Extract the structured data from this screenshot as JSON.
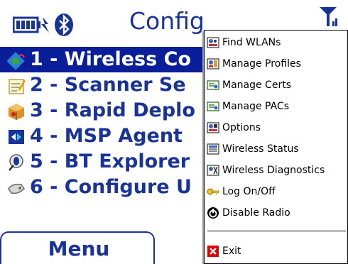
{
  "title": "Config",
  "status_icons": [
    "battery-icon",
    "bluetooth-icon",
    "antenna-icon"
  ],
  "list": [
    {
      "label": "1 - Wireless Co",
      "icon": "wireless-icon",
      "selected": true
    },
    {
      "label": "2 - Scanner Se",
      "icon": "notepad-icon",
      "selected": false
    },
    {
      "label": "3 - Rapid Deplo",
      "icon": "package-icon",
      "selected": false
    },
    {
      "label": "4 - MSP Agent",
      "icon": "msp-agent-icon",
      "selected": false
    },
    {
      "label": "5 - BT Explorer",
      "icon": "bluetooth-explorer-icon",
      "selected": false
    },
    {
      "label": "6 - Configure U",
      "icon": "configure-icon",
      "selected": false
    }
  ],
  "softkey": {
    "menu_label": "Menu"
  },
  "popup_menu": {
    "items": [
      {
        "label": "Find WLANs",
        "icon": "find-wlans-icon"
      },
      {
        "label": "Manage Profiles",
        "icon": "manage-profiles-icon"
      },
      {
        "label": "Manage Certs",
        "icon": "certificate-icon"
      },
      {
        "label": "Manage PACs",
        "icon": "pac-icon"
      },
      {
        "label": "Options",
        "icon": "options-icon"
      },
      {
        "label": "Wireless Status",
        "icon": "wireless-status-icon"
      },
      {
        "label": "Wireless Diagnostics",
        "icon": "wireless-diagnostics-icon"
      },
      {
        "label": "Log On/Off",
        "icon": "key-icon"
      },
      {
        "label": "Disable Radio",
        "icon": "power-icon"
      }
    ],
    "exit": {
      "label": "Exit",
      "icon": "exit-icon"
    }
  },
  "colors": {
    "accent": "#1a3399",
    "selection": "#0a1e9a",
    "exit": "#e00000"
  }
}
